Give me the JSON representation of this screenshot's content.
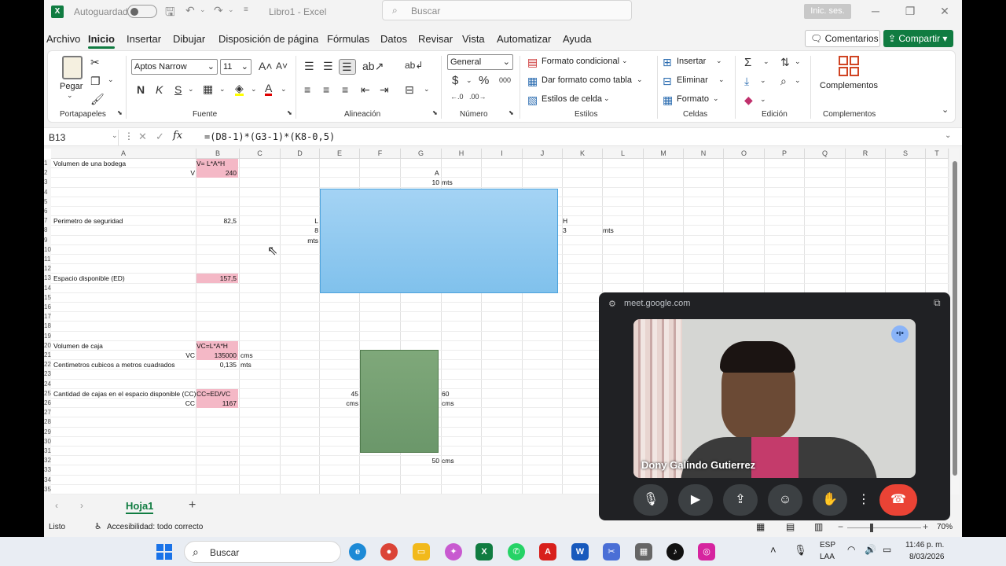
{
  "titlebar": {
    "autosave_label": "Autoguardado",
    "doc_title": "Libro1  -  Excel",
    "search_placeholder": "Buscar",
    "signin_label": "Inic. ses."
  },
  "menu": {
    "tabs": [
      "Archivo",
      "Inicio",
      "Insertar",
      "Dibujar",
      "Disposición de página",
      "Fórmulas",
      "Datos",
      "Revisar",
      "Vista",
      "Automatizar",
      "Ayuda"
    ],
    "active_tab": "Inicio",
    "comments_label": "Comentarios",
    "share_label": "Compartir"
  },
  "ribbon": {
    "clipboard": {
      "paste_label": "Pegar",
      "group_label": "Portapapeles"
    },
    "font": {
      "font_name": "Aptos Narrow",
      "font_size": "11",
      "bold": "N",
      "italic": "K",
      "underline": "S",
      "group_label": "Fuente"
    },
    "alignment": {
      "group_label": "Alineación"
    },
    "number": {
      "format": "General",
      "group_label": "Número"
    },
    "styles": {
      "conditional": "Formato condicional",
      "table": "Dar formato como tabla",
      "cell_styles": "Estilos de celda",
      "group_label": "Estilos"
    },
    "cells": {
      "insert": "Insertar",
      "delete": "Eliminar",
      "format": "Formato",
      "group_label": "Celdas"
    },
    "editing": {
      "group_label": "Edición"
    },
    "addins": {
      "button_label": "Complementos",
      "group_label": "Complementos"
    }
  },
  "formula_bar": {
    "name_box": "B13",
    "formula": "=(D8-1)*(G3-1)*(K8-0,5)"
  },
  "grid": {
    "columns": [
      "A",
      "B",
      "C",
      "D",
      "E",
      "F",
      "G",
      "H",
      "I",
      "J",
      "K",
      "L",
      "M",
      "N",
      "O",
      "P",
      "Q",
      "R",
      "S",
      "T"
    ],
    "rows": [
      "1",
      "2",
      "3",
      "4",
      "5",
      "6",
      "7",
      "8",
      "9",
      "10",
      "11",
      "12",
      "13",
      "14",
      "15",
      "16",
      "17",
      "18",
      "19",
      "20",
      "21",
      "22",
      "23",
      "24",
      "25",
      "26",
      "27",
      "28",
      "29",
      "30",
      "31",
      "32",
      "33",
      "34",
      "35"
    ],
    "cells": {
      "a1": "Volumen de una bodega",
      "b1": "V= L*A*H",
      "a2": "V",
      "b2": "240",
      "g2": "A",
      "g3": "10",
      "h3": "mts",
      "a7": "Perimetro de seguridad",
      "b7": "82,5",
      "d7": "L",
      "k7": "H",
      "d8": "8",
      "k8": "3",
      "l8": "mts",
      "d9": "mts",
      "a13": "Espacio disponible (ED)",
      "b13": "157,5",
      "a20": "Volumen de caja",
      "b20": "VC=L*A*H",
      "a21": "VC",
      "b21": "135000",
      "c21": "cms",
      "a22": "Centimetros cubicos a metros cuadrados",
      "b22": "0,135",
      "c22": "mts",
      "a25": "Cantidad de cajas en el espacio disponible (CC)",
      "b25": "CC=ED/VC",
      "e25": "45",
      "h25": "60",
      "a26": "CC",
      "b26": "1167",
      "e26": "cms",
      "h26": "cms",
      "g32": "50",
      "h32": "cms"
    }
  },
  "sheets": {
    "active": "Hoja1"
  },
  "status": {
    "ready": "Listo",
    "accessibility": "Accesibilidad: todo correcto",
    "zoom": "70%"
  },
  "meet": {
    "url": "meet.google.com",
    "participant": "Dony Galindo Gutierrez"
  },
  "taskbar": {
    "search_placeholder": "Buscar",
    "lang1": "ESP",
    "lang2": "LAA",
    "time": "11:46 p. m.",
    "date": "8/03/2026"
  },
  "colors": {
    "excel_green": "#107c41",
    "pink_cell": "#f4b8c6",
    "blue_rect": "#8fc8ee",
    "green_rect": "#7fa87a",
    "end_call": "#ea4335"
  }
}
